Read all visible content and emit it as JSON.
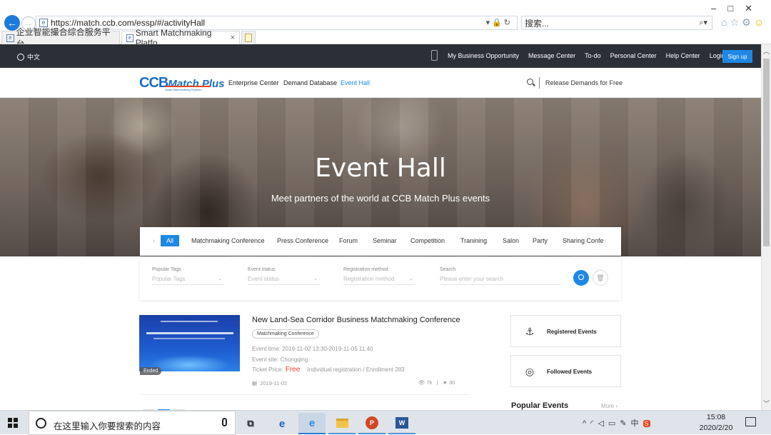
{
  "browser": {
    "url": "https://match.ccb.com/essp/#/activityHall",
    "search_placeholder": "搜索...",
    "tabs": [
      {
        "label": "企业智能撮合综合服务平台"
      },
      {
        "label": "Smart Matchmaking Platfo...",
        "close": "×"
      }
    ]
  },
  "topbar": {
    "language": "中文",
    "links": [
      "My Business Opportunity",
      "Message Center",
      "To-do",
      "Personal Center",
      "Help Center",
      "Login"
    ],
    "signup": "Sign up"
  },
  "navbar": {
    "logo_main": "CCB",
    "logo_plus": "Match Plus",
    "logo_tagline": "Smart Matchmaking Platform",
    "items": [
      {
        "label": "Enterprise Center"
      },
      {
        "label": "Demand Database"
      },
      {
        "label": "Event Hall",
        "active": true
      }
    ],
    "release": "Release Demands for Free"
  },
  "hero": {
    "title": "Event Hall",
    "subtitle": "Meet partners of the world at CCB Match Plus events"
  },
  "categories": [
    "All",
    "Matchmaking Conference",
    "Press Conference",
    "Forum",
    "Seminar",
    "Competition",
    "Tranining",
    "Salon",
    "Party",
    "Sharing Confe"
  ],
  "filters": {
    "tags": {
      "label": "Popular Tags",
      "placeholder": "Popular Tags"
    },
    "status": {
      "label": "Event status",
      "placeholder": "Event status"
    },
    "registration": {
      "label": "Registration method",
      "placeholder": "Registration method"
    },
    "search": {
      "label": "Search",
      "placeholder": "Please enter your search"
    }
  },
  "event": {
    "badge": "Ended",
    "title": "New Land-Sea Corridor Business Matchmaking Conference",
    "tag": "Matchmaking Conference",
    "time_label": "Event time:",
    "time": "2019-11-02 13:30-2019-11-05 11:40",
    "site_label": "Event site:",
    "site": "Chongqing",
    "price_label": "Ticket Price:",
    "price": "Free",
    "registration": "Individual registration / Enrollment 283",
    "date": "2019-11-02",
    "views": "7k",
    "stars": "30"
  },
  "sidebar": {
    "registered": "Registered Events",
    "followed": "Followed Events",
    "popular_title": "Popular Events",
    "more": "More"
  },
  "taskbar": {
    "search_text": "在这里输入你要搜索的内容",
    "ime": "中",
    "time": "15:08",
    "date": "2020/2/20"
  }
}
